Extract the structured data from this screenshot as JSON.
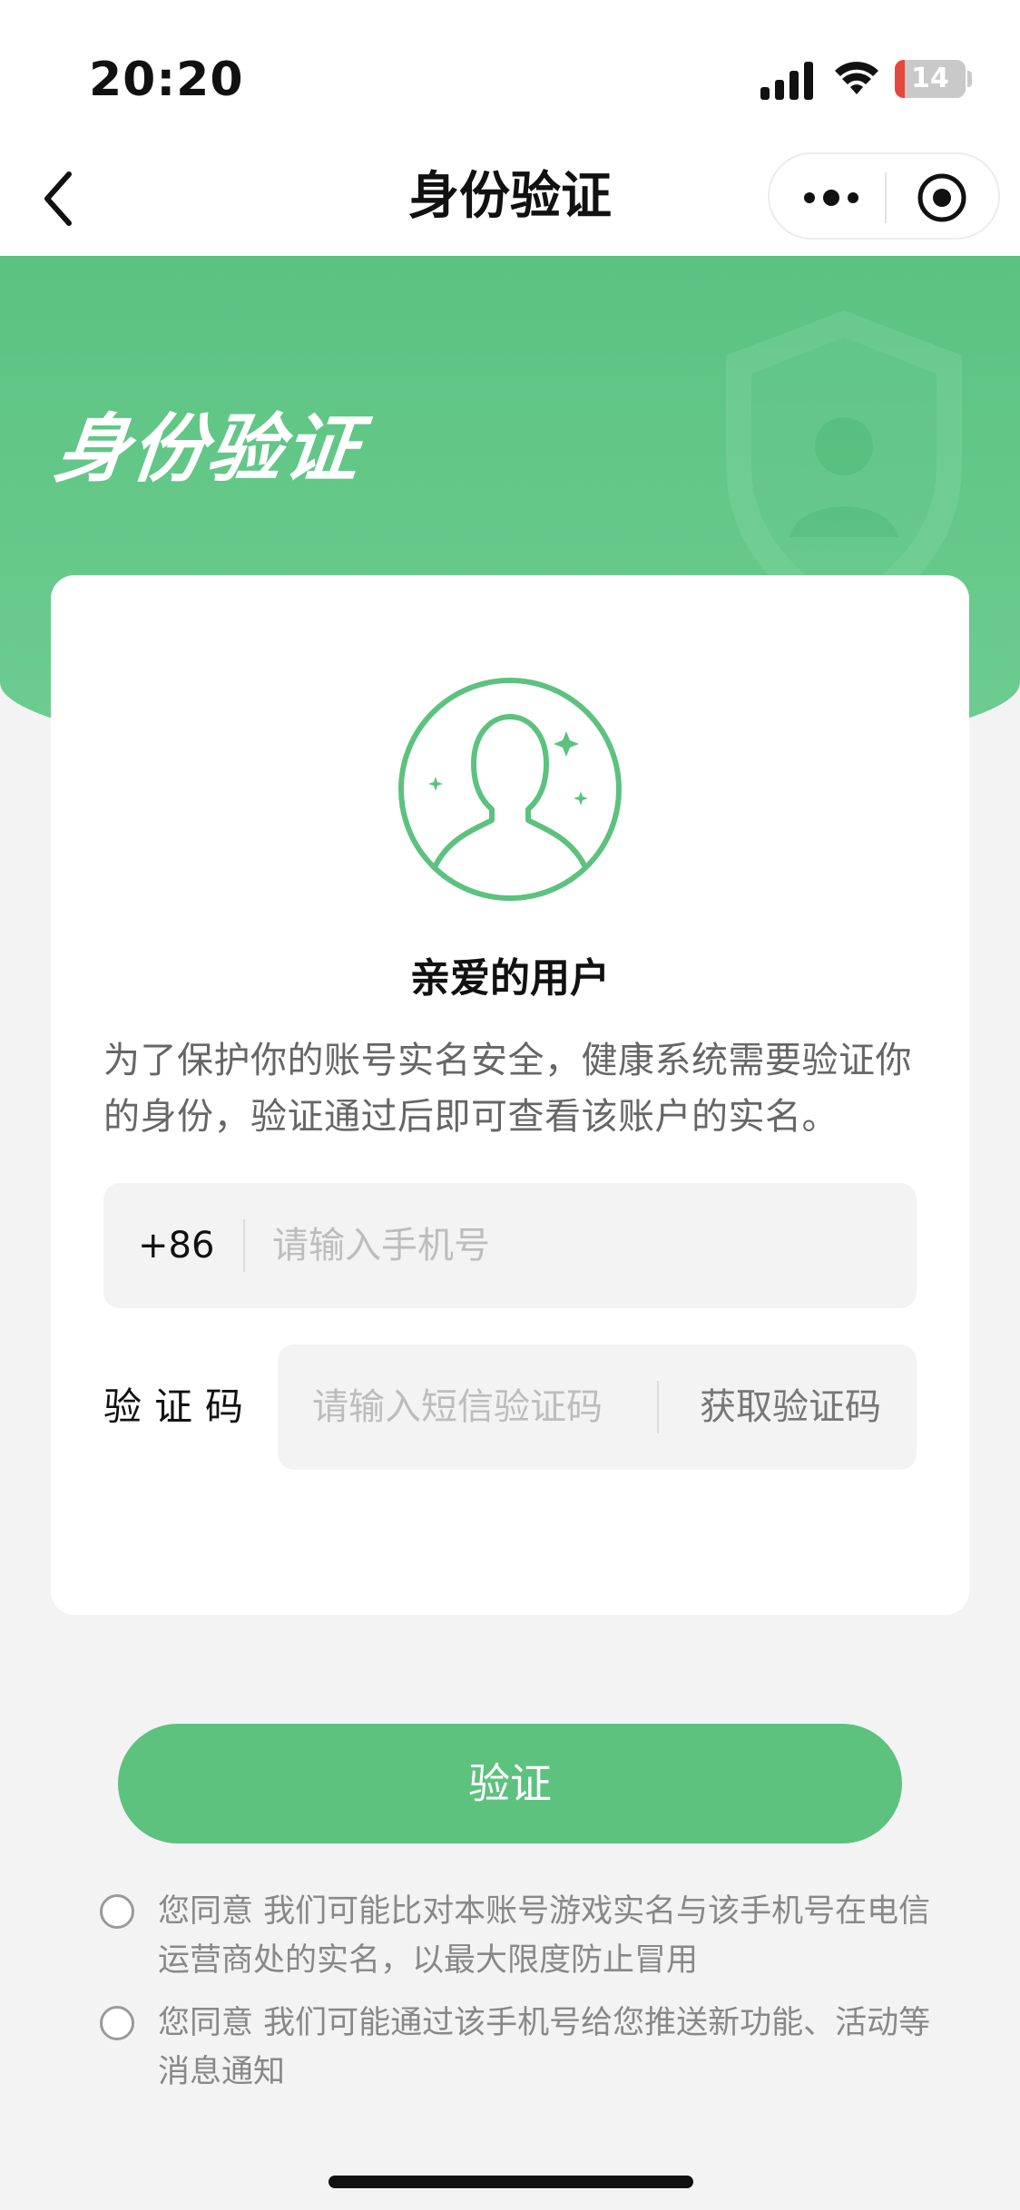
{
  "status_bar": {
    "time": "20:20",
    "battery_level": "14",
    "battery_fraction": 0.14,
    "icons": [
      "signal-icon",
      "wifi-icon",
      "battery-icon"
    ]
  },
  "nav": {
    "title": "身份验证",
    "icons": [
      "back-icon",
      "more-icon",
      "close-mini-program-icon"
    ]
  },
  "banner": {
    "title": "身份验证",
    "icons": [
      "shield-icon"
    ]
  },
  "card": {
    "avatar_icon": "user-avatar-icon",
    "greeting": "亲爱的用户",
    "description": "为了保护你的账号实名安全，健康系统需要验证你的身份，验证通过后即可查看该账户的实名。",
    "phone": {
      "country_code": "+86",
      "value": "",
      "placeholder": "请输入手机号"
    },
    "code": {
      "label": "验证码",
      "value": "",
      "placeholder": "请输入短信验证码",
      "get_code_label": "获取验证码"
    }
  },
  "verify_button": {
    "label": "验证"
  },
  "agreements": [
    {
      "text": "您同意 我们可能比对本账号游戏实名与该手机号在电信运营商处的实名，以最大限度防止冒用",
      "checked": false
    },
    {
      "text": "您同意 我们可能通过该手机号给您推送新功能、活动等消息通知",
      "checked": false
    }
  ],
  "colors": {
    "brand_green": "#5cc27e",
    "banner_green": "#66c98a",
    "battery_low": "#e5463d"
  }
}
